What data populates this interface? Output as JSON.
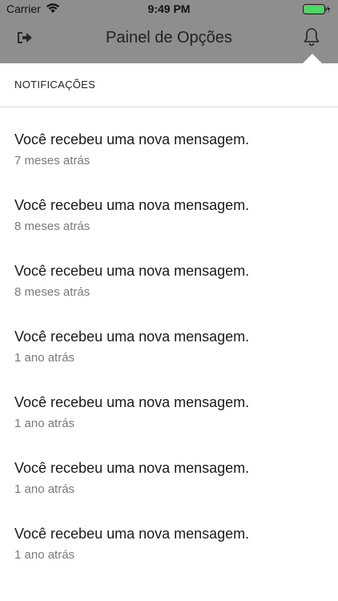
{
  "status_bar": {
    "carrier": "Carrier",
    "time": "9:49 PM",
    "battery_color": "#4cd964"
  },
  "nav": {
    "title": "Painel de Opções",
    "left_icon": "logout-icon",
    "right_icon": "bell-icon",
    "bar_color": "#8e8e8e"
  },
  "notifications": {
    "header": "NOTIFICAÇÕES",
    "items": [
      {
        "message": "Você recebeu uma nova mensagem.",
        "time": "7 meses atrás"
      },
      {
        "message": "Você recebeu uma nova mensagem.",
        "time": "8 meses atrás"
      },
      {
        "message": "Você recebeu uma nova mensagem.",
        "time": "8 meses atrás"
      },
      {
        "message": "Você recebeu uma nova mensagem.",
        "time": "1 ano atrás"
      },
      {
        "message": "Você recebeu uma nova mensagem.",
        "time": "1 ano atrás"
      },
      {
        "message": "Você recebeu uma nova mensagem.",
        "time": "1 ano atrás"
      },
      {
        "message": "Você recebeu uma nova mensagem.",
        "time": "1 ano atrás"
      }
    ]
  }
}
